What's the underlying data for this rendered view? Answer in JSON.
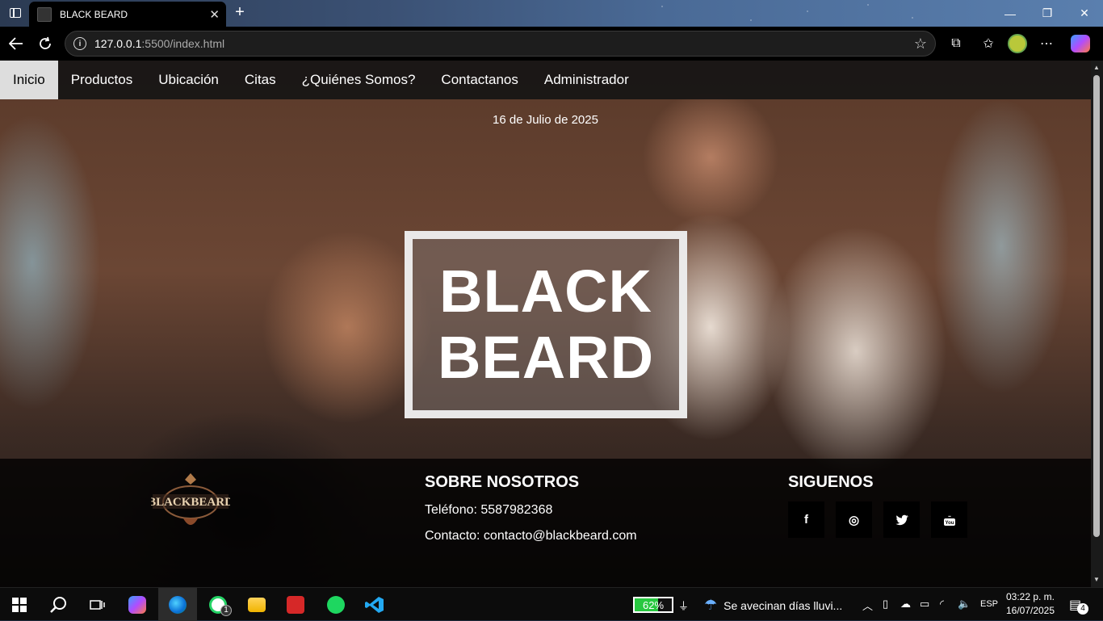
{
  "browser": {
    "tab_title": "BLACK BEARD",
    "tab_close": "✕",
    "new_tab": "+",
    "url_host": "127.0.0.1",
    "url_path": ":5500/index.html",
    "window_controls": {
      "minimize": "—",
      "maximize": "❐",
      "close": "✕"
    }
  },
  "nav": {
    "items": [
      {
        "label": "Inicio",
        "active": true
      },
      {
        "label": "Productos"
      },
      {
        "label": "Ubicación"
      },
      {
        "label": "Citas"
      },
      {
        "label": "¿Quiénes Somos?"
      },
      {
        "label": "Contactanos"
      },
      {
        "label": "Administrador"
      }
    ]
  },
  "hero": {
    "date": "16 de Julio de 2025",
    "title_line1": "BLACK",
    "title_line2": "BEARD"
  },
  "footer": {
    "brand_logo_text": "BLACKBEARD",
    "about_heading": "SOBRE NOSOTROS",
    "phone": "Teléfono: 5587982368",
    "contact": "Contacto: contacto@blackbeard.com",
    "social_heading": "SIGUENOS",
    "social": [
      {
        "name": "facebook",
        "glyph": "f"
      },
      {
        "name": "instagram",
        "glyph": "◎"
      },
      {
        "name": "twitter",
        "glyph": "🐦"
      },
      {
        "name": "youtube",
        "glyph": "▶"
      }
    ]
  },
  "taskbar": {
    "battery_percent": "62%",
    "battery_level": 0.62,
    "weather_text": "Se avecinan días lluvi...",
    "language": "ESP",
    "time": "03:22 p. m.",
    "date": "16/07/2025",
    "notification_count": "4",
    "whatsapp_badge": "1"
  },
  "colors": {
    "nav_active_bg": "#dddddd",
    "footer_bg": "#000000",
    "battery_fill": "#28c840"
  }
}
